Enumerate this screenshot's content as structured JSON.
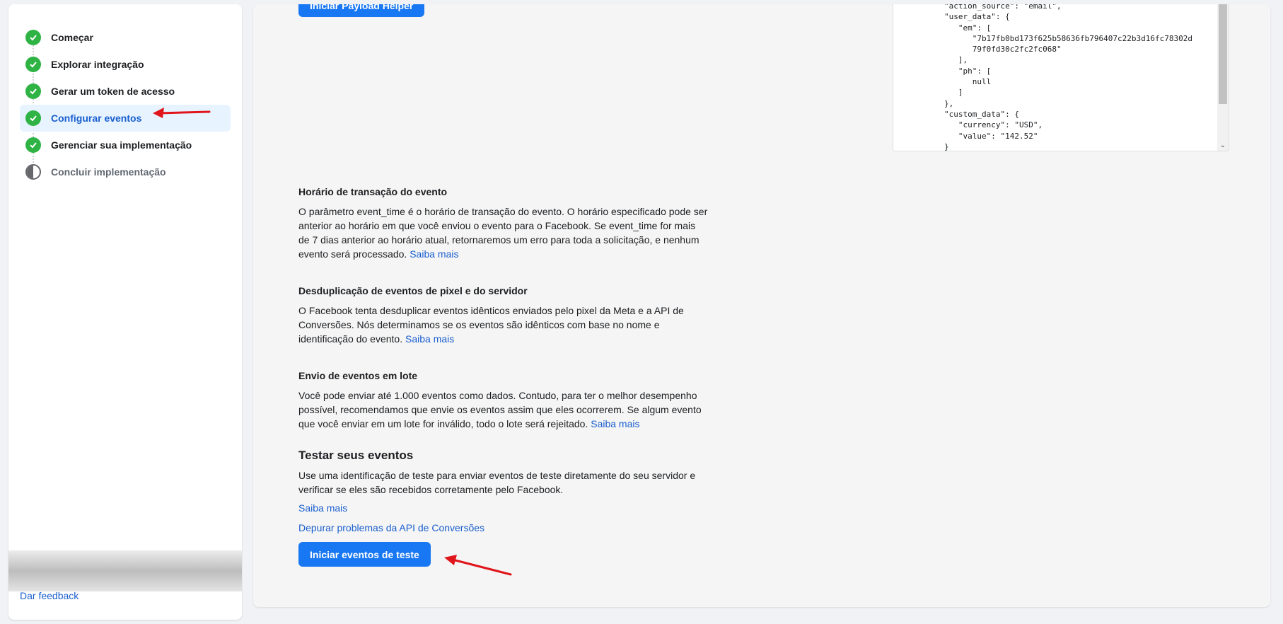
{
  "sidebar": {
    "steps": [
      {
        "label": "Começar",
        "status": "done"
      },
      {
        "label": "Explorar integração",
        "status": "done"
      },
      {
        "label": "Gerar um token de acesso",
        "status": "done"
      },
      {
        "label": "Configurar eventos",
        "status": "active"
      },
      {
        "label": "Gerenciar sua implementação",
        "status": "done"
      },
      {
        "label": "Concluir implementação",
        "status": "pending"
      }
    ],
    "feedback": "Dar feedback"
  },
  "main": {
    "payload_button": "Iniciar Payload Helper",
    "code_lines": [
      "\"action_source\": \"email\",",
      "\"user_data\": {",
      "   \"em\": [",
      "      \"7b17fb0bd173f625b58636fb796407c22b3d16fc78302d",
      "      79f0fd30c2fc2fc068\"",
      "   ],",
      "   \"ph\": [",
      "      null",
      "   ]",
      "},",
      "\"custom_data\": {",
      "   \"currency\": \"USD\",",
      "   \"value\": \"142.52\"",
      "}"
    ],
    "sections": {
      "event_time": {
        "title": "Horário de transação do evento",
        "text": "O parâmetro event_time é o horário de transação do evento. O horário especificado pode ser anterior ao horário em que você enviou o evento para o Facebook. Se event_time for mais de 7 dias anterior ao horário atual, retornaremos um erro para toda a solicitação, e nenhum evento será processado.",
        "link": "Saiba mais"
      },
      "dedup": {
        "title": "Desduplicação de eventos de pixel e do servidor",
        "text": "O Facebook tenta desduplicar eventos idênticos enviados pelo pixel da Meta e a API de Conversões. Nós determinamos se os eventos são idênticos com base no nome e identificação do evento.",
        "link": "Saiba mais"
      },
      "batch": {
        "title": "Envio de eventos em lote",
        "text": "Você pode enviar até 1.000 eventos como dados. Contudo, para ter o melhor desempenho possível, recomendamos que envie os eventos assim que eles ocorrerem. Se algum evento que você enviar em um lote for inválido, todo o lote será rejeitado.",
        "link": "Saiba mais"
      }
    },
    "test": {
      "title": "Testar seus eventos",
      "text": "Use uma identificação de teste para enviar eventos de teste diretamente do seu servidor e verificar se eles são recebidos corretamente pelo Facebook.",
      "link_more": "Saiba mais",
      "link_debug": "Depurar problemas da API de Conversões",
      "button": "Iniciar eventos de teste"
    }
  },
  "colors": {
    "accent": "#1877f2",
    "link": "#1a5fcf",
    "done": "#2fb344",
    "annotation": "#e0151b"
  }
}
